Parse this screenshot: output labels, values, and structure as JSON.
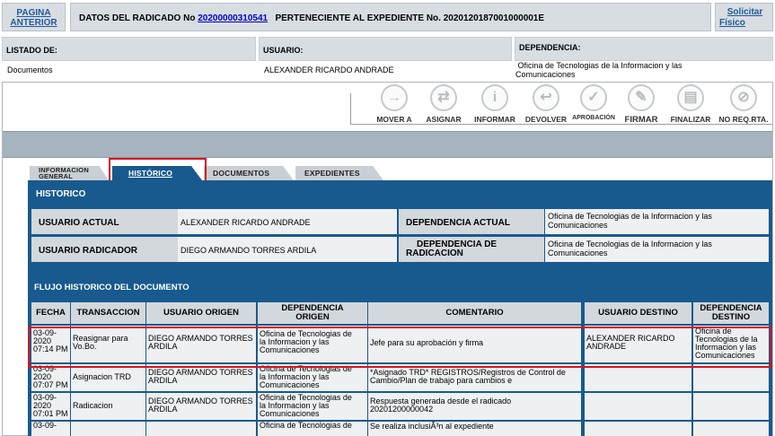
{
  "header": {
    "pagina_anterior": [
      "PAGINA",
      "ANTERIOR"
    ],
    "radicado_label": "DATOS DEL RADICADO No",
    "radicado_number": "20200000310541",
    "expediente_text": "PERTENECIENTE AL EXPEDIENTE No. 2020120187001000001E",
    "solicitar_fisico": [
      "Solicitar",
      "Físico"
    ]
  },
  "listado": {
    "listado_label": "LISTADO DE:",
    "usuario_label": "USUARIO:",
    "dependencia_label": "DEPENDENCIA:",
    "listado_value": "Documentos",
    "usuario_value": "ALEXANDER RICARDO ANDRADE",
    "dependencia_value": [
      "Oficina de Tecnologias de la Informacion y las",
      "Comunicaciones"
    ]
  },
  "toolbar": {
    "buttons": [
      {
        "label": "MOVER A",
        "icon": "arrow-right-icon",
        "glyph": "→"
      },
      {
        "label": "ASIGNAR",
        "icon": "assign-docs-icon",
        "glyph": "⇄"
      },
      {
        "label": "INFORMAR",
        "icon": "info-icon",
        "glyph": "i"
      },
      {
        "label": "DEVOLVER",
        "icon": "return-arrow-icon",
        "glyph": "↩"
      },
      {
        "label": "APROBACIÓN",
        "icon": "checkmark-icon",
        "glyph": "✓"
      },
      {
        "label": "FIRMAR",
        "icon": "signature-icon",
        "glyph": "✎"
      },
      {
        "label": "FINALIZAR",
        "icon": "finish-doc-icon",
        "glyph": "▤"
      },
      {
        "label": "NO REQ.RTA.",
        "icon": "no-reply-icon",
        "glyph": "⊘"
      }
    ]
  },
  "tabs": {
    "informacion_general": [
      "INFORMACION",
      "GENERAL"
    ],
    "historico": "HISTÓRICO",
    "documentos": "DOCUMENTOS",
    "expedientes": "EXPEDIENTES"
  },
  "historico": {
    "title": "HISTORICO",
    "usuario_actual_label": "USUARIO ACTUAL",
    "usuario_actual": "ALEXANDER RICARDO ANDRADE",
    "dependencia_actual_label": "DEPENDENCIA ACTUAL",
    "dependencia_actual": [
      "Oficina de Tecnologias de la Informacion y las",
      "Comunicaciones"
    ],
    "usuario_radicador_label": "USUARIO RADICADOR",
    "usuario_radicador": "DIEGO ARMANDO TORRES ARDILA",
    "dependencia_radicacion_label": [
      "DEPENDENCIA DE",
      "RADICACION"
    ],
    "dependencia_radicacion": [
      "Oficina de Tecnologias de la Informacion y las",
      "Comunicaciones"
    ]
  },
  "flujo": {
    "title": "FLUJO HISTORICO DEL DOCUMENTO",
    "columns": [
      "FECHA",
      "TRANSACCION",
      "USUARIO ORIGEN",
      [
        "DEPENDENCIA",
        "ORIGEN"
      ],
      "COMENTARIO",
      "USUARIO DESTINO",
      [
        "DEPENDENCIA",
        "DESTINO"
      ]
    ],
    "rows": [
      {
        "fecha": [
          "03-09-",
          "2020",
          "07:14 PM"
        ],
        "transaccion": [
          "Reasignar para",
          "Vo.Bo."
        ],
        "usuario_origen": [
          "DIEGO ARMANDO TORRES",
          "ARDILA"
        ],
        "dependencia_origen": [
          "Oficina de Tecnologias de",
          "la Informacion y las",
          "Comunicaciones"
        ],
        "comentario": [
          "Jefe para su aprobación y firma"
        ],
        "usuario_destino": [
          "ALEXANDER RICARDO",
          "ANDRADE"
        ],
        "dependencia_destino": [
          "Oficina de",
          "Tecnologias de la",
          "Informacion y las",
          "Comunicaciones"
        ]
      },
      {
        "fecha": [
          "03-09-",
          "2020",
          "07:07 PM"
        ],
        "transaccion": [
          "Asignacion TRD"
        ],
        "usuario_origen": [
          "DIEGO ARMANDO TORRES",
          "ARDILA"
        ],
        "dependencia_origen": [
          "Oficina de Tecnologias de",
          "la Informacion y las",
          "Comunicaciones"
        ],
        "comentario": [
          "*Asignado TRD* REGISTROS/Registros de Control de",
          "Cambio/Plan de trabajo para cambios e"
        ],
        "usuario_destino": [],
        "dependencia_destino": []
      },
      {
        "fecha": [
          "03-09-",
          "2020",
          "07:01 PM"
        ],
        "transaccion": [
          "Radicacion"
        ],
        "usuario_origen": [
          "DIEGO ARMANDO TORRES",
          "ARDILA"
        ],
        "dependencia_origen": [
          "Oficina de Tecnologias de",
          "la Informacion y las",
          "Comunicaciones"
        ],
        "comentario": [
          "Respuesta generada desde el radicado",
          "20201200000042"
        ],
        "usuario_destino": [],
        "dependencia_destino": []
      },
      {
        "fecha": [
          "03-09-"
        ],
        "transaccion": [],
        "usuario_origen": [],
        "dependencia_origen": [
          "Oficina de Tecnologias de"
        ],
        "comentario": [
          "Se realiza inclusiÃ³n al expediente"
        ],
        "usuario_destino": [],
        "dependencia_destino": []
      }
    ]
  }
}
